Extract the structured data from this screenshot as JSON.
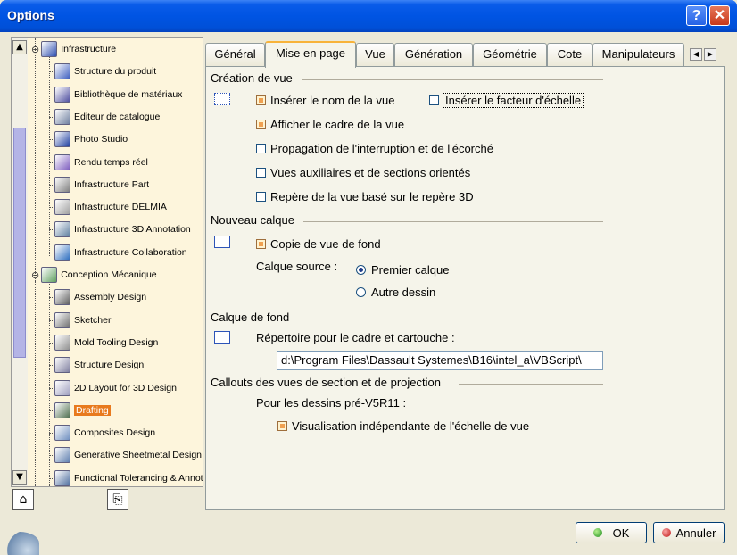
{
  "window": {
    "title": "Options",
    "help_label": "?",
    "close_label": "✕"
  },
  "tree": {
    "items": [
      {
        "label": "Infrastructure",
        "level": 0,
        "icon": "infrastructure-icon",
        "color": "#3050b0"
      },
      {
        "label": "Structure du produit",
        "level": 1,
        "icon": "product-structure-icon",
        "color": "#4060c0"
      },
      {
        "label": "Bibliothèque de matériaux",
        "level": 1,
        "icon": "material-library-icon",
        "color": "#5050a0"
      },
      {
        "label": "Editeur de catalogue",
        "level": 1,
        "icon": "catalog-editor-icon",
        "color": "#7080a0"
      },
      {
        "label": "Photo Studio",
        "level": 1,
        "icon": "photo-studio-icon",
        "color": "#2040a0"
      },
      {
        "label": "Rendu temps réel",
        "level": 1,
        "icon": "realtime-render-icon",
        "color": "#8060c0"
      },
      {
        "label": "Infrastructure Part",
        "level": 1,
        "icon": "gear-icon",
        "color": "#808080"
      },
      {
        "label": "Infrastructure DELMIA",
        "level": 1,
        "icon": "delmia-icon",
        "color": "#a0a0a0"
      },
      {
        "label": "Infrastructure 3D Annotation",
        "level": 1,
        "icon": "annotation-icon",
        "color": "#6080a0"
      },
      {
        "label": "Infrastructure Collaboration",
        "level": 1,
        "icon": "collaboration-icon",
        "color": "#3070c0"
      },
      {
        "label": "Conception Mécanique",
        "level": 0,
        "icon": "mechanical-design-icon",
        "color": "#60a060"
      },
      {
        "label": "Assembly Design",
        "level": 1,
        "icon": "assembly-icon",
        "color": "#606060"
      },
      {
        "label": "Sketcher",
        "level": 1,
        "icon": "sketcher-icon",
        "color": "#707070"
      },
      {
        "label": "Mold Tooling Design",
        "level": 1,
        "icon": "mold-tooling-icon",
        "color": "#909090"
      },
      {
        "label": "Structure Design",
        "level": 1,
        "icon": "structure-design-icon",
        "color": "#8080a0"
      },
      {
        "label": "2D Layout for 3D Design",
        "level": 1,
        "icon": "layout-2d-icon",
        "color": "#a0a0c0"
      },
      {
        "label": "Drafting",
        "level": 1,
        "icon": "drafting-icon",
        "color": "#507050",
        "selected": true
      },
      {
        "label": "Composites Design",
        "level": 1,
        "icon": "composites-icon",
        "color": "#7090c0"
      },
      {
        "label": "Generative Sheetmetal Design",
        "level": 1,
        "icon": "sheetmetal-icon",
        "color": "#6080b0"
      },
      {
        "label": "Functional Tolerancing & Annotation",
        "level": 1,
        "icon": "tolerancing-icon",
        "color": "#5070a0"
      }
    ]
  },
  "tabs": [
    {
      "label": "Général",
      "active": false
    },
    {
      "label": "Mise en page",
      "active": true
    },
    {
      "label": "Vue",
      "active": false
    },
    {
      "label": "Génération",
      "active": false
    },
    {
      "label": "Géométrie",
      "active": false
    },
    {
      "label": "Cote",
      "active": false
    },
    {
      "label": "Manipulateurs",
      "active": false
    }
  ],
  "tab_scroll": {
    "left": "◀",
    "right": "▶"
  },
  "sections": {
    "creation": {
      "title": "Création de vue",
      "insert_name": {
        "label": "Insérer le nom de la vue",
        "checked": true
      },
      "insert_scale": {
        "label": "Insérer le  facteur d'échelle",
        "checked": false
      },
      "show_frame": {
        "label": "Afficher le cadre de la vue",
        "checked": true
      },
      "propagation": {
        "label": "Propagation de l'interruption et de l'écorché",
        "checked": false
      },
      "aux_views": {
        "label": "Vues auxiliaires et de sections orientés",
        "checked": false
      },
      "ref_3d": {
        "label": "Repère de la vue basé sur le repère 3D",
        "checked": false
      }
    },
    "new_sheet": {
      "title": "Nouveau calque",
      "copy_bg": {
        "label": "Copie de vue de fond",
        "checked": true
      },
      "source_label": "Calque source :",
      "first_sheet": {
        "label": "Premier calque",
        "selected": true
      },
      "other_drawing": {
        "label": "Autre dessin",
        "selected": false
      }
    },
    "background": {
      "title": "Calque de fond",
      "dir_label": "Répertoire pour le cadre et cartouche :",
      "dir_value": "d:\\Program Files\\Dassault Systemes\\B16\\intel_a\\VBScript\\"
    },
    "callouts": {
      "title": "Callouts des vues de section et de projection",
      "pre_label": "Pour les dessins pré-V5R11 :",
      "independent": {
        "label": "Visualisation indépendante de l'échelle de vue",
        "checked": true
      }
    }
  },
  "buttons": {
    "ok": "OK",
    "cancel": "Annuler"
  },
  "colors": {
    "accent": "#e87a1e",
    "titlebar": "#0054e3",
    "tree_bg": "#fdf5dc"
  }
}
